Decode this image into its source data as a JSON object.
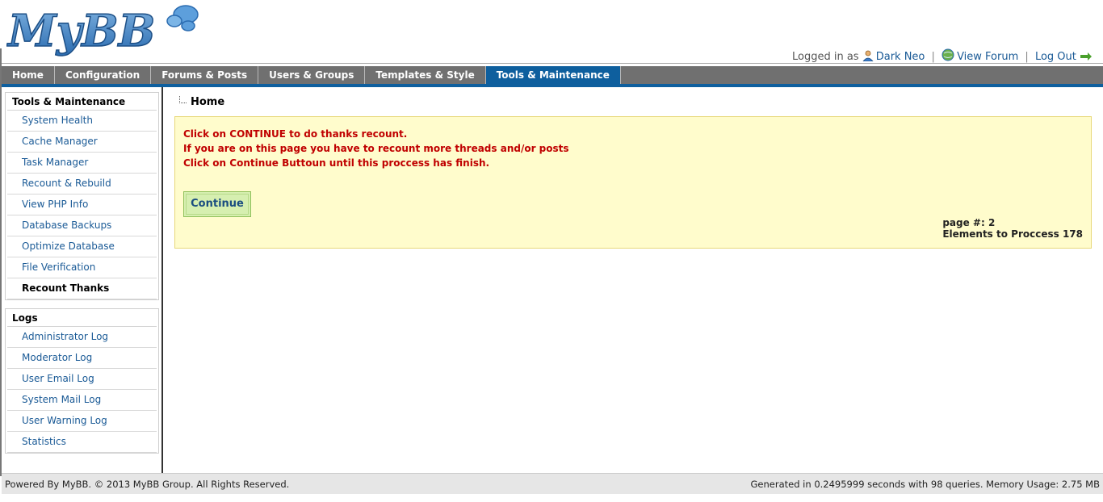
{
  "header": {
    "logo_text": "MyBB",
    "logged_in_as": "Logged in as",
    "user_name": "Dark Neo",
    "view_forum": "View Forum",
    "log_out": "Log Out",
    "separator": "|"
  },
  "menu": {
    "tabs": [
      {
        "label": "Home"
      },
      {
        "label": "Configuration"
      },
      {
        "label": "Forums & Posts"
      },
      {
        "label": "Users & Groups"
      },
      {
        "label": "Templates & Style"
      },
      {
        "label": "Tools & Maintenance"
      }
    ],
    "active_index": 5
  },
  "sidebar": {
    "sections": [
      {
        "title": "Tools & Maintenance",
        "items": [
          {
            "label": "System Health"
          },
          {
            "label": "Cache Manager"
          },
          {
            "label": "Task Manager"
          },
          {
            "label": "Recount & Rebuild"
          },
          {
            "label": "View PHP Info"
          },
          {
            "label": "Database Backups"
          },
          {
            "label": "Optimize Database"
          },
          {
            "label": "File Verification"
          },
          {
            "label": "Recount Thanks"
          }
        ],
        "active_index": 8
      },
      {
        "title": "Logs",
        "items": [
          {
            "label": "Administrator Log"
          },
          {
            "label": "Moderator Log"
          },
          {
            "label": "User Email Log"
          },
          {
            "label": "System Mail Log"
          },
          {
            "label": "User Warning Log"
          },
          {
            "label": "Statistics"
          }
        ]
      }
    ]
  },
  "breadcrumb": {
    "label": "Home"
  },
  "notice": {
    "line1": "Click on CONTINUE to do thanks recount.",
    "line2": "If you are on this page you have to recount more threads and/or posts",
    "line3": "Click on Continue Buttoun until this proccess has finish.",
    "button_label": "Continue",
    "page_label": "page #: 2",
    "elements_label": "Elements to Proccess 178"
  },
  "footer": {
    "left": "Powered By MyBB. © 2013 MyBB Group. All Rights Reserved.",
    "right": "Generated in 0.2495999 seconds with 98 queries. Memory Usage: 2.75 MB"
  },
  "colors": {
    "menu_bg": "#707070",
    "menu_active": "#0e5f9e",
    "link": "#1a5a96",
    "notice_bg": "#fffccc",
    "notice_text": "#c00000",
    "button_bg": "#d6efb0"
  }
}
